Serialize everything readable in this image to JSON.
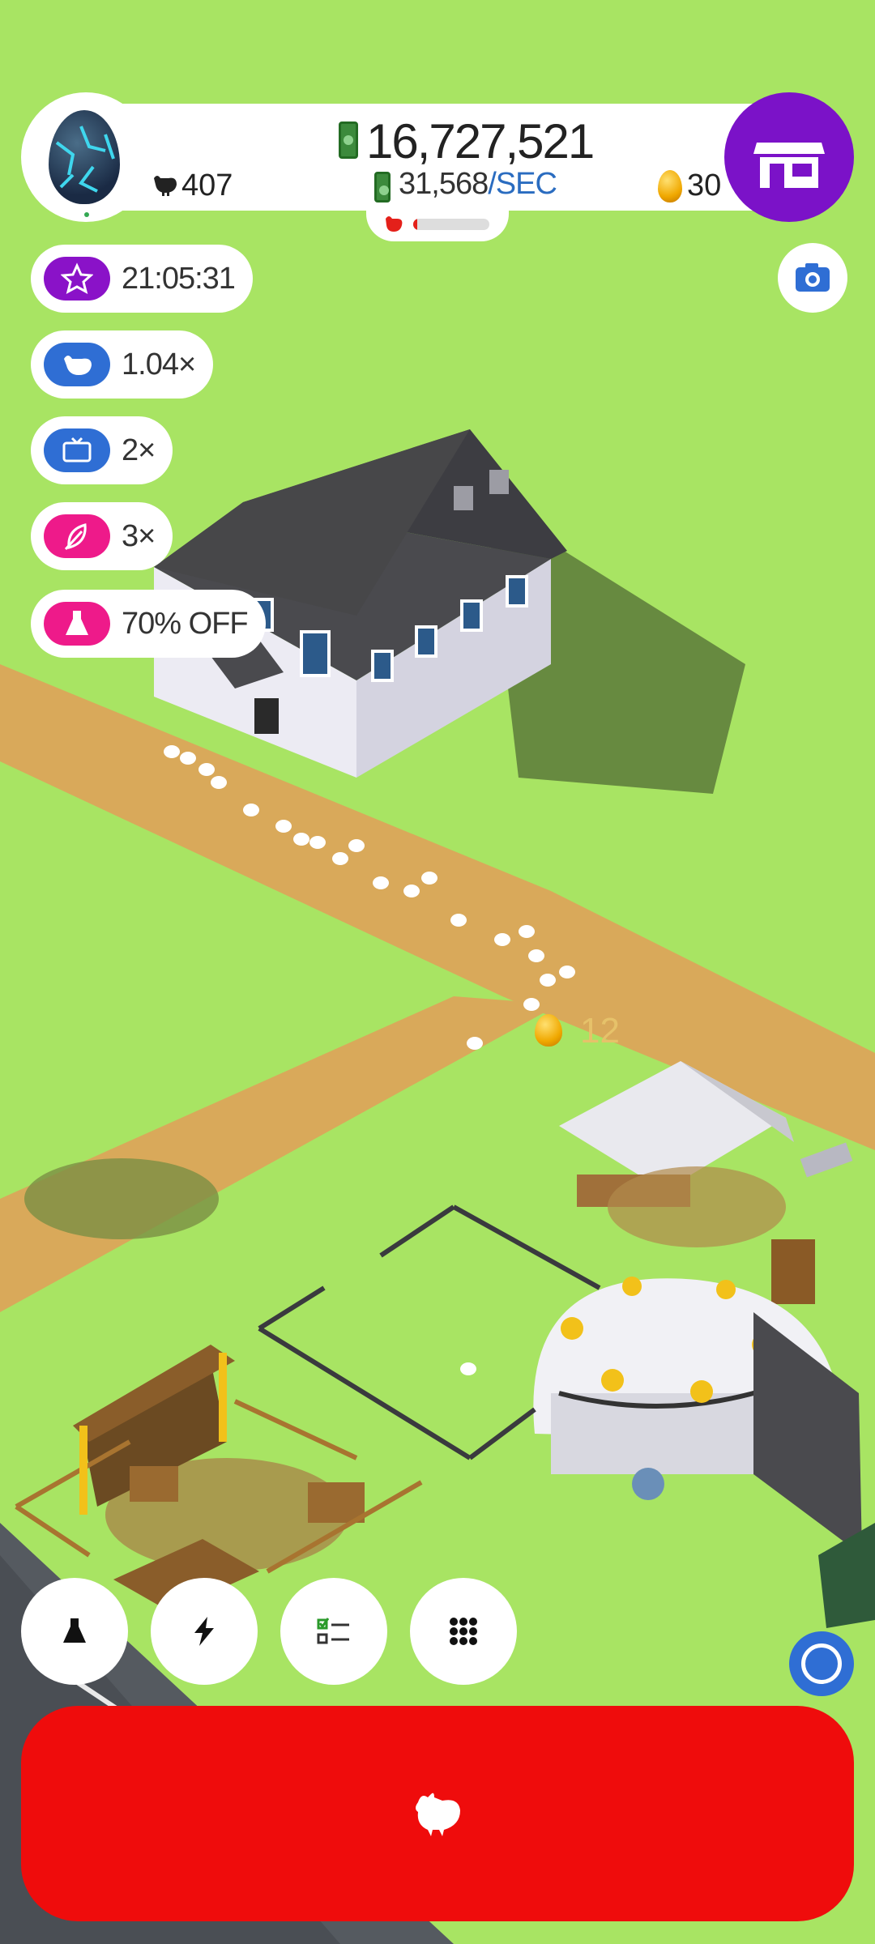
{
  "header": {
    "money": "16,727,521",
    "rate_value": "31,568",
    "rate_unit": "/SEC",
    "chicken_count": "407",
    "golden_eggs": "30",
    "hatch_progress": 0.05
  },
  "boosts": [
    {
      "label": "21:05:31",
      "icon": "star-icon",
      "color": "#8a12c8"
    },
    {
      "label": "1.04×",
      "icon": "chicken-boost-icon",
      "color": "#2f6ed4"
    },
    {
      "label": "2×",
      "icon": "tv-icon",
      "color": "#2f6ed4"
    },
    {
      "label": "3×",
      "icon": "feather-icon",
      "color": "#ee1a8a"
    },
    {
      "label": "70% OFF",
      "icon": "flask-icon",
      "color": "#ee1a8a"
    }
  ],
  "floating_coin": "12",
  "bottom_buttons": [
    {
      "name": "research-button",
      "icon": "flask-icon"
    },
    {
      "name": "boost-button",
      "icon": "lightning-icon"
    },
    {
      "name": "quests-button",
      "icon": "checklist-icon"
    },
    {
      "name": "menu-button",
      "icon": "grid-icon"
    }
  ],
  "colors": {
    "grass": "#a8e463",
    "path": "#d9a95a",
    "shop": "#7b12c8",
    "hatch": "#ef0c0c",
    "blue": "#2f6ed4"
  }
}
